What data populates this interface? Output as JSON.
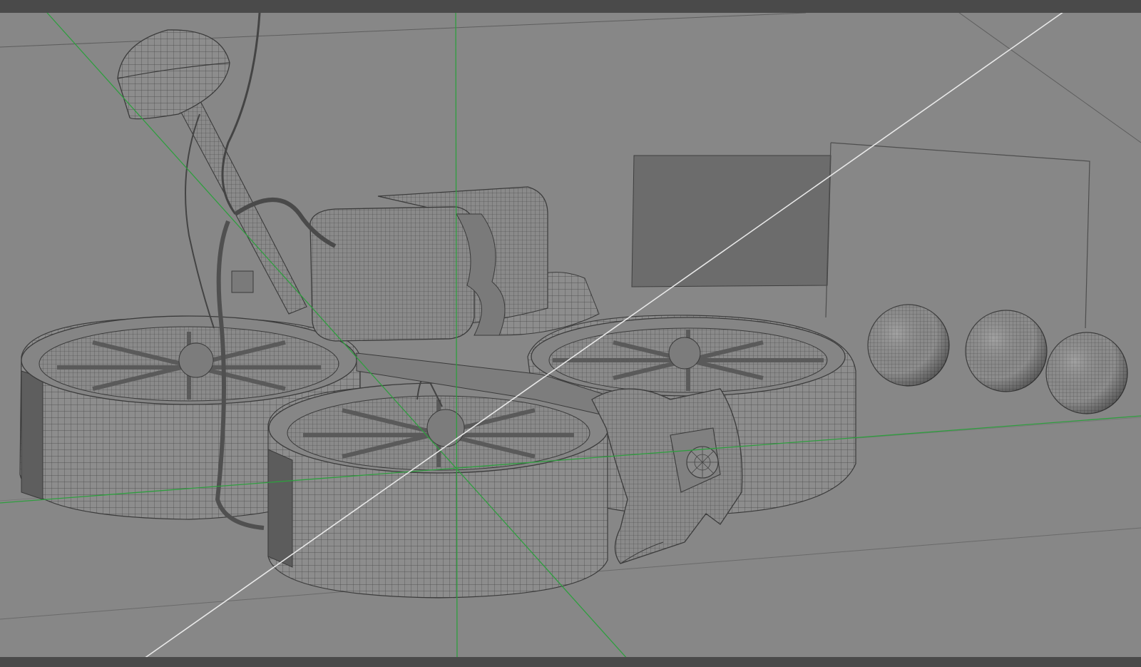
{
  "viewport": {
    "background_color": "#878787",
    "axis_color": "#2f9e3f",
    "guide_line_color": "#e8e8e8",
    "wire_color": "#3a3a3a",
    "frame_bar_color": "#4a4a4a"
  },
  "scene": {
    "objects": [
      "antenna",
      "camera-unit",
      "duct-left",
      "duct-front",
      "duct-right",
      "duct-back",
      "gimbal-camera",
      "backdrop-plane",
      "sphere-1",
      "sphere-2",
      "sphere-3"
    ],
    "sphere_count": 3
  }
}
